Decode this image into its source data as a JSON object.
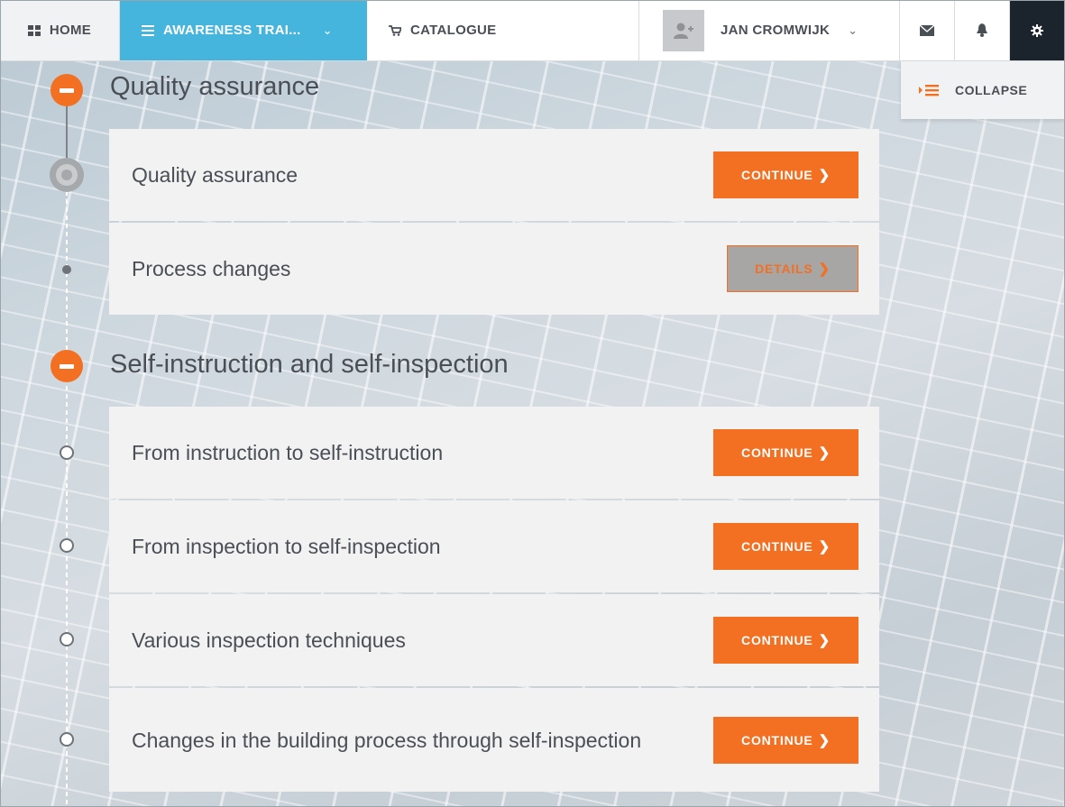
{
  "navbar": {
    "home_label": "HOME",
    "training_label": "AWARENESS TRAI...",
    "catalogue_label": "CATALOGUE",
    "user_name": "JAN CROMWIJK"
  },
  "panel": {
    "collapse_label": "COLLAPSE"
  },
  "sections": [
    {
      "title": "Quality assurance",
      "items": [
        {
          "title": "Quality assurance",
          "action": "CONTINUE"
        },
        {
          "title": "Process changes",
          "action": "DETAILS"
        }
      ]
    },
    {
      "title": "Self-instruction and self-inspection",
      "items": [
        {
          "title": "From instruction to self-instruction",
          "action": "CONTINUE"
        },
        {
          "title": "From inspection to self-inspection",
          "action": "CONTINUE"
        },
        {
          "title": "Various inspection techniques",
          "action": "CONTINUE"
        },
        {
          "title": "Changes in the building process through self-inspection",
          "action": "CONTINUE"
        }
      ]
    }
  ],
  "colors": {
    "accent": "#f36f21",
    "active_tab": "#45b5de",
    "dark": "#1b242d"
  }
}
